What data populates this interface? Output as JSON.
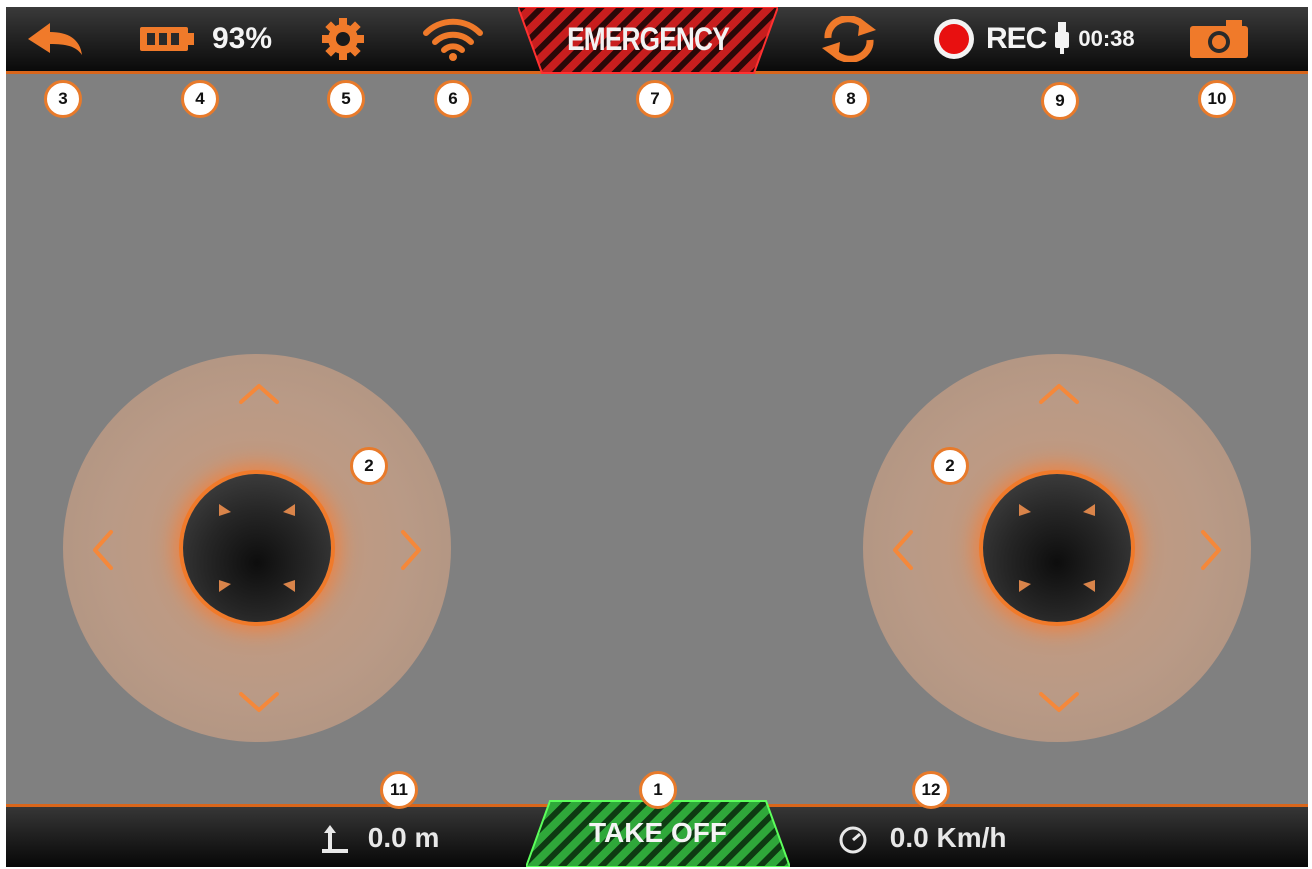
{
  "topbar": {
    "back_icon": "back-arrow-icon",
    "battery_icon": "battery-icon",
    "battery_percent": "93%",
    "settings_icon": "gear-icon",
    "wifi_icon": "wifi-icon",
    "emergency_label": "EMERGENCY",
    "flip_icon": "refresh-icon",
    "rec_label": "REC",
    "rec_time": "00:38",
    "photo_icon": "camera-icon"
  },
  "callouts": {
    "n1": "1",
    "n2": "2",
    "n3": "3",
    "n4": "4",
    "n5": "5",
    "n6": "6",
    "n7": "7",
    "n8": "8",
    "n9": "9",
    "n10": "10",
    "n11": "11",
    "n12": "12"
  },
  "bottombar": {
    "takeoff_label": "TAKE OFF",
    "altitude_value": "0.0 m",
    "speed_value": "0.0 Km/h"
  },
  "colors": {
    "accent": "#e87a2a",
    "emergency_red": "#c81e1e",
    "takeoff_green": "#2fa83a",
    "record_red": "#e81010",
    "screen_gray": "#808080"
  }
}
